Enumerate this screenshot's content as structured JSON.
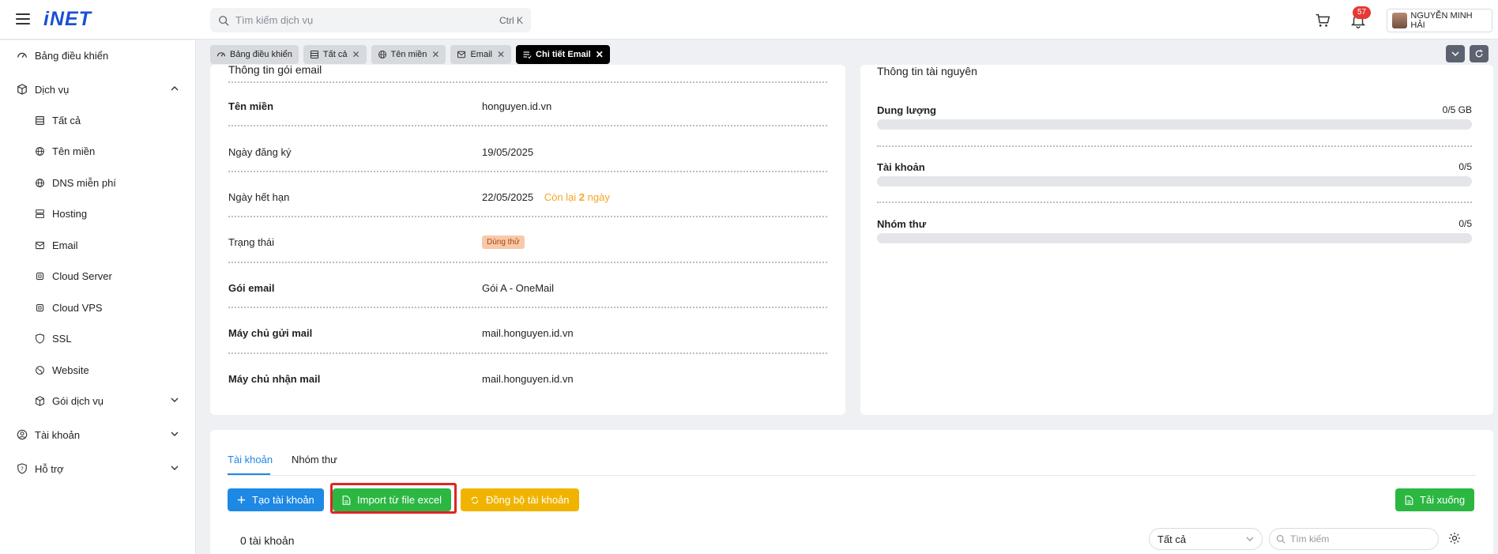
{
  "brand": {
    "logo": "iNET"
  },
  "header": {
    "search_placeholder": "Tìm kiếm dịch vụ",
    "search_shortcut": "Ctrl K",
    "notification_count": "57",
    "user_name": "NGUYỄN MINH HẢI"
  },
  "sidebar": {
    "items": [
      {
        "label": "Bảng điều khiển",
        "icon": "gauge-icon"
      },
      {
        "label": "Dịch vụ",
        "icon": "cube-icon"
      },
      {
        "label": "Tất cả",
        "icon": "table-icon"
      },
      {
        "label": "Tên miền",
        "icon": "globe-icon"
      },
      {
        "label": "DNS miễn phí",
        "icon": "globe-icon"
      },
      {
        "label": "Hosting",
        "icon": "server-icon"
      },
      {
        "label": "Email",
        "icon": "mail-icon"
      },
      {
        "label": "Cloud Server",
        "icon": "cpu-icon"
      },
      {
        "label": "Cloud VPS",
        "icon": "cpu-icon"
      },
      {
        "label": "SSL",
        "icon": "shield-icon"
      },
      {
        "label": "Website",
        "icon": "web-icon"
      },
      {
        "label": "Gói dịch vụ",
        "icon": "cube-icon"
      },
      {
        "label": "Tài khoản",
        "icon": "user-circle-icon"
      },
      {
        "label": "Hỗ trợ",
        "icon": "help-icon"
      }
    ]
  },
  "tabs": [
    {
      "label": "Bảng điều khiển"
    },
    {
      "label": "Tất cả"
    },
    {
      "label": "Tên miền"
    },
    {
      "label": "Email"
    },
    {
      "label": "Chi tiết Email"
    }
  ],
  "email_info": {
    "title": "Thông tin gói email",
    "rows": [
      {
        "label": "Tên miền",
        "value": "honguyen.id.vn"
      },
      {
        "label": "Ngày đăng ký",
        "value": "19/05/2025"
      },
      {
        "label": "Ngày hết hạn",
        "value": "22/05/2025",
        "remaining_prefix": "Còn lại",
        "remaining_days": "2",
        "remaining_suffix": "ngày"
      },
      {
        "label": "Trạng thái",
        "value": "Dùng thử"
      },
      {
        "label": "Gói email",
        "value": "Gói A - OneMail"
      },
      {
        "label": "Máy chủ gửi mail",
        "value": "mail.honguyen.id.vn"
      },
      {
        "label": "Máy chủ nhận mail",
        "value": "mail.honguyen.id.vn"
      }
    ]
  },
  "resources": {
    "title": "Thông tin tài nguyên",
    "items": [
      {
        "label": "Dung lượng",
        "value": "0/5 GB",
        "used": 0
      },
      {
        "label": "Tài khoản",
        "value": "0/5",
        "used": 0
      },
      {
        "label": "Nhóm thư",
        "value": "0/5",
        "used": 0
      }
    ]
  },
  "accounts": {
    "tabs": [
      "Tài khoản",
      "Nhóm thư"
    ],
    "create_btn": "Tạo tài khoản",
    "import_btn": "Import từ file excel",
    "sync_btn": "Đồng bộ tài khoản",
    "download_btn": "Tải xuống",
    "count_label": "0 tài khoản",
    "filter_value": "Tất cả",
    "search_placeholder": "Tìm kiếm"
  },
  "colors": {
    "accent": "#1e88e5",
    "brand": "#1a4fd6",
    "green": "#2cb742",
    "yellow": "#f0b400",
    "highlight": "#e02424"
  }
}
